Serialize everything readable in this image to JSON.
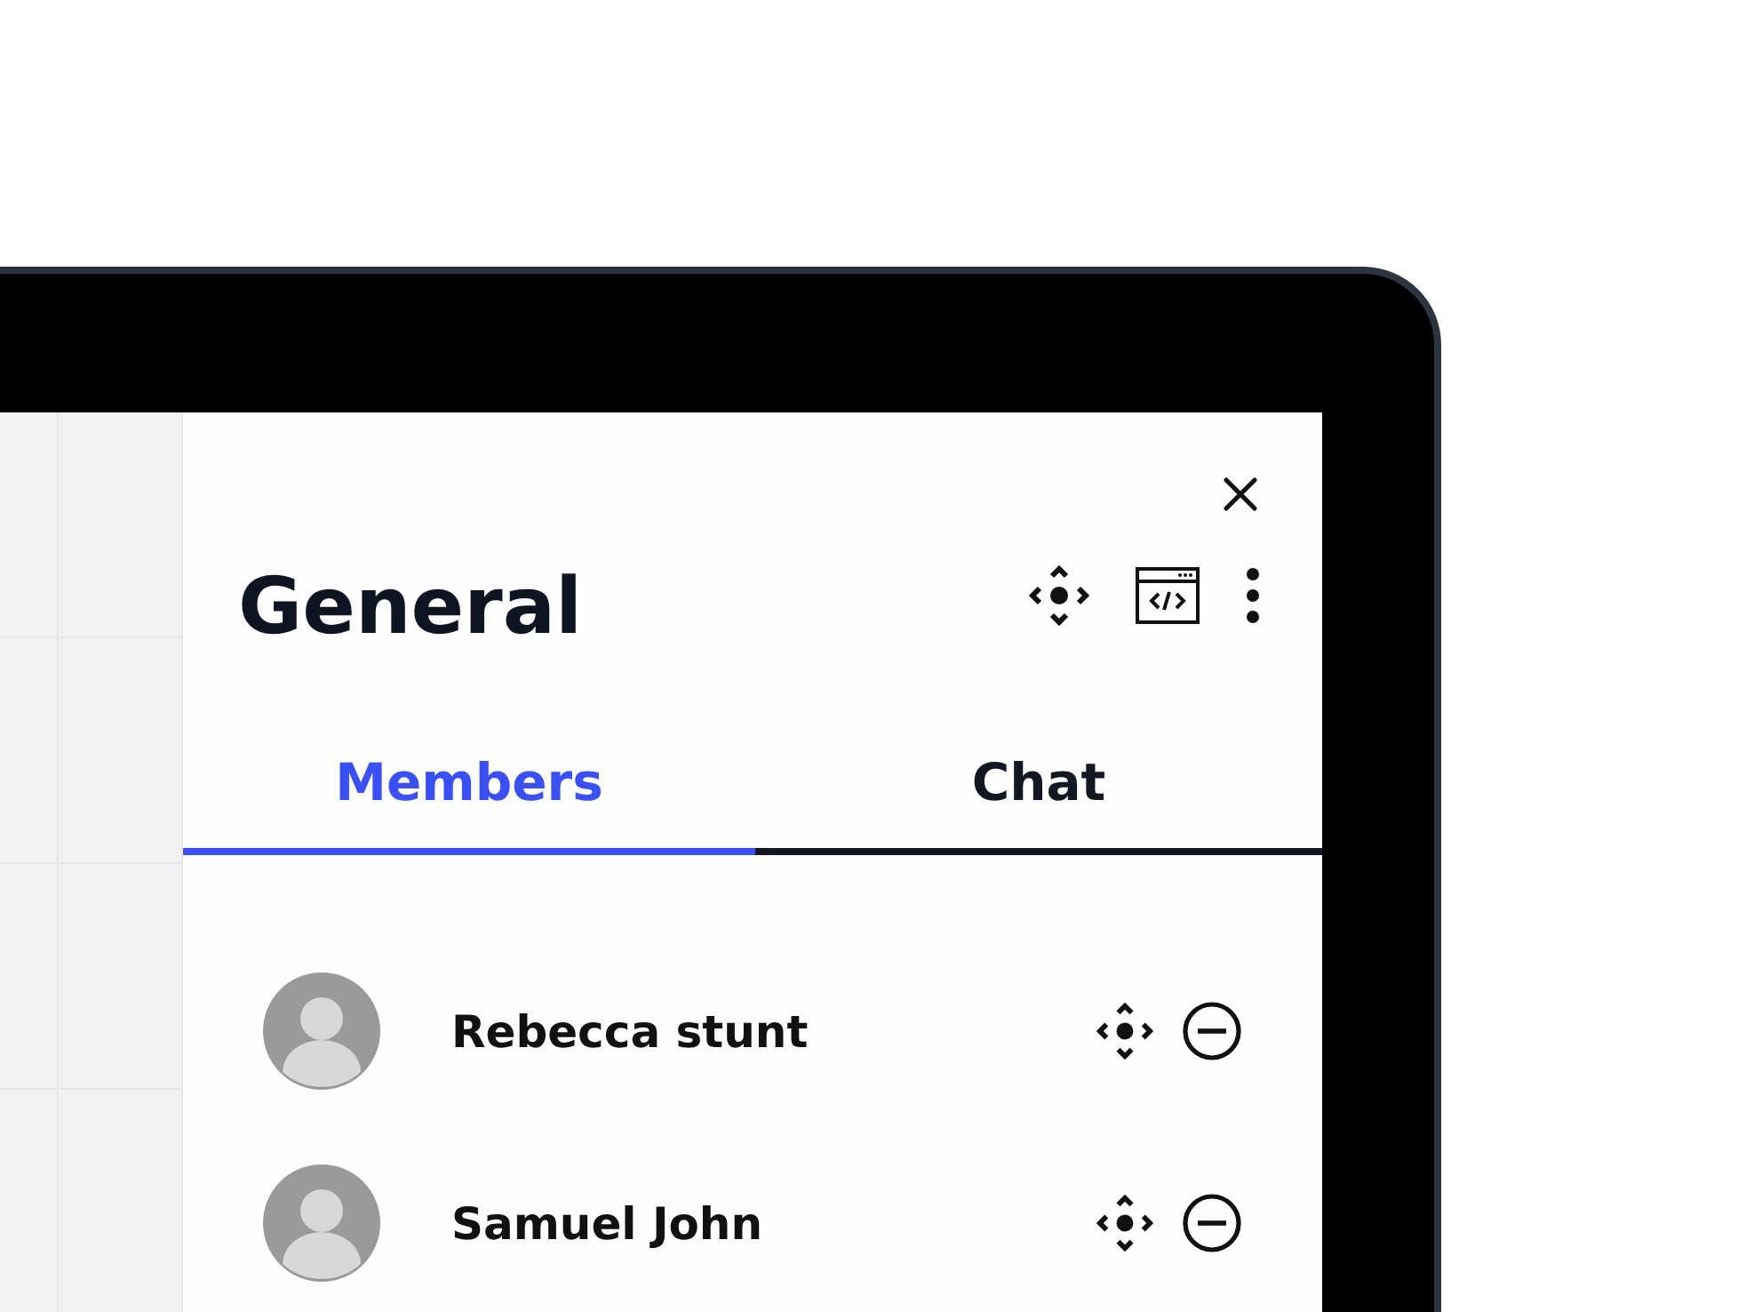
{
  "panel": {
    "title": "General"
  },
  "tabs": [
    {
      "label": "Members",
      "selected": true
    },
    {
      "label": "Chat",
      "selected": false
    }
  ],
  "members": [
    {
      "name": "Rebecca stunt"
    },
    {
      "name": "Samuel John"
    }
  ]
}
